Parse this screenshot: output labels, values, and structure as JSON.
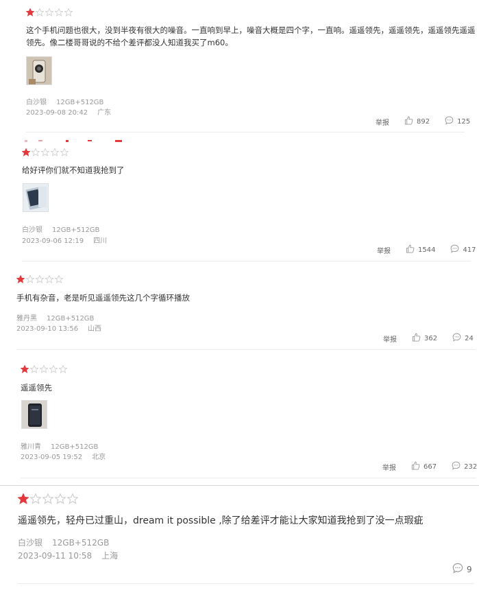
{
  "colors": {
    "star_fill": "#e4393c",
    "star_empty": "#cfcfcf",
    "text": "#333333",
    "meta": "#999999"
  },
  "reviews": [
    {
      "rating": 1,
      "max": 5,
      "content_line1": "这个手机问题也很大，没到半夜有很大的噪音。一直响到早上，噪音大概是四个字，一直响。遥遥领先，遥遥领先，遥遥领先遥遥",
      "content_line2": "领先。像二楼哥哥说的不给个差评都没人知道我买了m60。",
      "color": "白沙银",
      "spec": "12GB+512GB",
      "date": "2023-09-08 20:42",
      "location": "广东",
      "report": "举报",
      "likes": "892",
      "comments": "125"
    },
    {
      "rating": 1,
      "max": 5,
      "content_line1": "给好评你们就不知道我抢到了",
      "color": "白沙银",
      "spec": "12GB+512GB",
      "date": "2023-09-06 12:19",
      "location": "四川",
      "report": "举报",
      "likes": "1544",
      "comments": "417"
    },
    {
      "rating": 1,
      "max": 5,
      "content_line1": "手机有杂音，老是听见遥遥领先这几个字循环播放",
      "color": "雅丹黑",
      "spec": "12GB+512GB",
      "date": "2023-09-10 13:56",
      "location": "山西",
      "report": "举报",
      "likes": "362",
      "comments": "24"
    },
    {
      "rating": 1,
      "max": 5,
      "content_line1": "遥遥领先",
      "color": "雅川青",
      "spec": "12GB+512GB",
      "date": "2023-09-05 19:52",
      "location": "北京",
      "report": "举报",
      "likes": "667",
      "comments": "232"
    },
    {
      "rating": 1,
      "max": 5,
      "content_line1": "遥遥领先，轻舟已过重山，dream it possible ,除了给差评才能让大家知道我抢到了没一点瑕疵",
      "color": "白沙银",
      "spec": "12GB+512GB",
      "date": "2023-09-11 10:58",
      "location": "上海",
      "comments": "9"
    }
  ]
}
